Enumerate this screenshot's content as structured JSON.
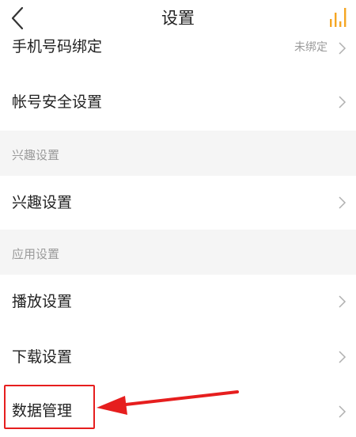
{
  "header": {
    "title": "设置"
  },
  "rows": [
    {
      "label": "手机号码绑定",
      "value": "未绑定"
    },
    {
      "label": "帐号安全设置",
      "value": ""
    },
    {
      "label": "兴趣设置",
      "value": ""
    },
    {
      "label": "播放设置",
      "value": ""
    },
    {
      "label": "下载设置",
      "value": ""
    },
    {
      "label": "数据管理",
      "value": ""
    }
  ],
  "sections": [
    {
      "label": "兴趣设置"
    },
    {
      "label": "应用设置"
    }
  ],
  "icons": {
    "back": "back-arrow-icon",
    "rank": "rank-chart-icon",
    "chevron": "chevron-right-icon"
  },
  "colors": {
    "accent": "#f5a623",
    "highlight": "#e61e1e",
    "section_bg": "#f5f5f5",
    "muted_text": "#9a9a9a"
  }
}
